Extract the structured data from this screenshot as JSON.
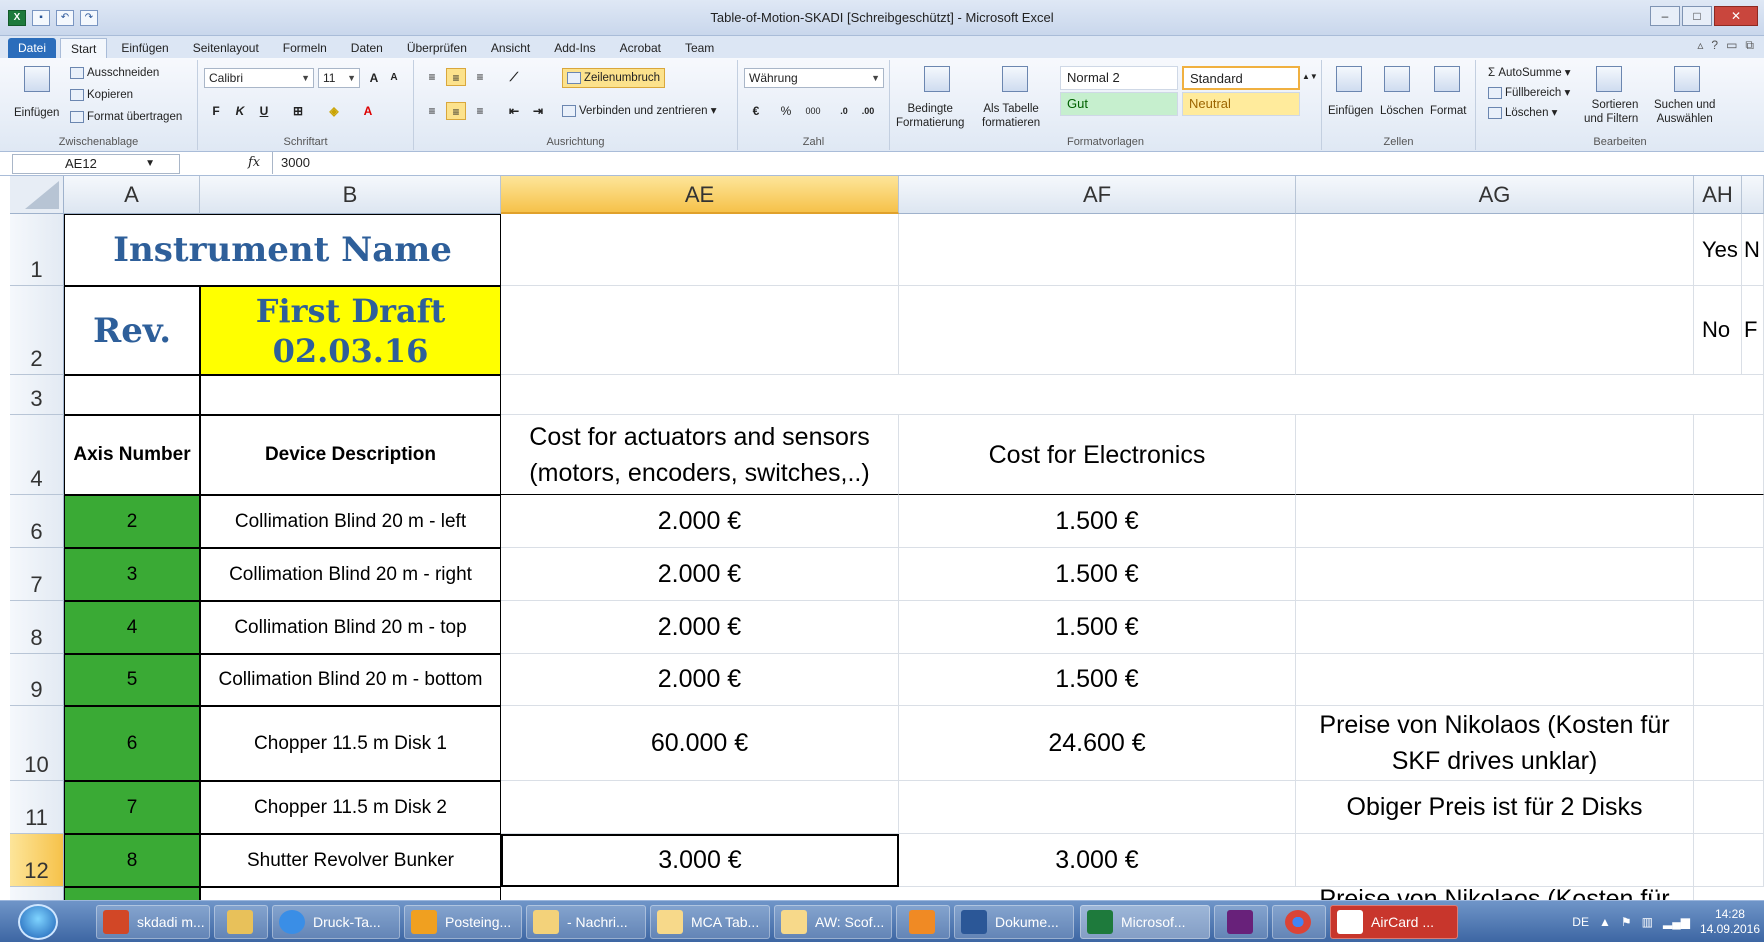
{
  "window": {
    "title": "Table-of-Motion-SKADI  [Schreibgeschützt]  - Microsoft Excel"
  },
  "quick_access": [
    "save-icon",
    "undo-icon",
    "redo-icon"
  ],
  "tabs": [
    "Datei",
    "Start",
    "Einfügen",
    "Seitenlayout",
    "Formeln",
    "Daten",
    "Überprüfen",
    "Ansicht",
    "Add-Ins",
    "Acrobat",
    "Team"
  ],
  "ribbon": {
    "clipboard": {
      "paste": "Einfügen",
      "cut": "Ausschneiden",
      "copy": "Kopieren",
      "format_painter": "Format übertragen",
      "label": "Zwischenablage"
    },
    "font": {
      "name": "Calibri",
      "size": "11",
      "label": "Schriftart",
      "bold": "F",
      "italic": "K",
      "underline": "U"
    },
    "alignment": {
      "wrap": "Zeilenumbruch",
      "merge": "Verbinden und zentrieren",
      "label": "Ausrichtung"
    },
    "number": {
      "format": "Währung",
      "percent": "%",
      "thousands": "000",
      "label": "Zahl"
    },
    "styles": {
      "conditional": "Bedingte\nFormatierung",
      "as_table": "Als Tabelle\nformatieren",
      "normal2": "Normal 2",
      "standard": "Standard",
      "good": "Gut",
      "neutral": "Neutral",
      "label": "Formatvorlagen"
    },
    "cells": {
      "insert": "Einfügen",
      "delete": "Löschen",
      "format": "Format",
      "label": "Zellen"
    },
    "editing": {
      "autosum": "AutoSumme",
      "fill": "Füllbereich",
      "clear": "Löschen",
      "sort": "Sortieren\nund Filtern",
      "find": "Suchen und\nAuswählen",
      "label": "Bearbeiten"
    }
  },
  "formula_bar": {
    "cell": "AE12",
    "fx": "fx",
    "value": "3000"
  },
  "columns": {
    "A": "A",
    "B": "B",
    "AE": "AE",
    "AF": "AF",
    "AG": "AG",
    "AH": "AH"
  },
  "rows": [
    "1",
    "2",
    "3",
    "4",
    "6",
    "7",
    "8",
    "9",
    "10",
    "11",
    "12"
  ],
  "cells": {
    "title": "Instrument Name",
    "rev_label": "Rev.",
    "rev_value": "First Draft\n02.03.16",
    "yes": "Yes",
    "yes_next": "N",
    "no": "No",
    "no_next": "F",
    "h_axis": "Axis Number",
    "h_device": "Device Description",
    "h_actuators": "Cost for actuators and sensors (motors, encoders, switches,..)",
    "h_electronics": "Cost for Electronics"
  },
  "table": [
    {
      "axis": "2",
      "device": "Collimation Blind 20 m - left",
      "act": "2.000 €",
      "elec": "1.500 €",
      "note": ""
    },
    {
      "axis": "3",
      "device": "Collimation Blind 20 m - right",
      "act": "2.000 €",
      "elec": "1.500 €",
      "note": ""
    },
    {
      "axis": "4",
      "device": "Collimation Blind 20 m - top",
      "act": "2.000 €",
      "elec": "1.500 €",
      "note": ""
    },
    {
      "axis": "5",
      "device": "Collimation Blind 20 m - bottom",
      "act": "2.000 €",
      "elec": "1.500 €",
      "note": ""
    },
    {
      "axis": "6",
      "device": "Chopper 11.5 m Disk 1",
      "act": "60.000 €",
      "elec": "24.600 €",
      "note": "Preise von Nikolaos (Kosten für SKF drives unklar)"
    },
    {
      "axis": "7",
      "device": "Chopper 11.5 m Disk 2",
      "act": "",
      "elec": "",
      "note": "Obiger Preis ist für 2 Disks"
    },
    {
      "axis": "8",
      "device": "Shutter Revolver Bunker",
      "act": "3.000 €",
      "elec": "3.000 €",
      "note": ""
    }
  ],
  "partial_next_row_note": "Preise von Nikolaos (Kosten für",
  "taskbar": {
    "items": [
      "skdadi m...",
      "",
      "Druck-Ta...",
      "Posteing...",
      "- Nachri...",
      "MCA Tab...",
      "AW: Scof...",
      "",
      "Dokume...",
      "Microsof...",
      "",
      "",
      "AirCard ..."
    ],
    "lang": "DE",
    "time": "14:28",
    "date": "14.09.2016"
  },
  "colors": {
    "axis_green": "#3aaa35",
    "rev_yellow": "#ffff00",
    "title_blue": "#2e5f9a",
    "selection": "#f6c24a"
  }
}
